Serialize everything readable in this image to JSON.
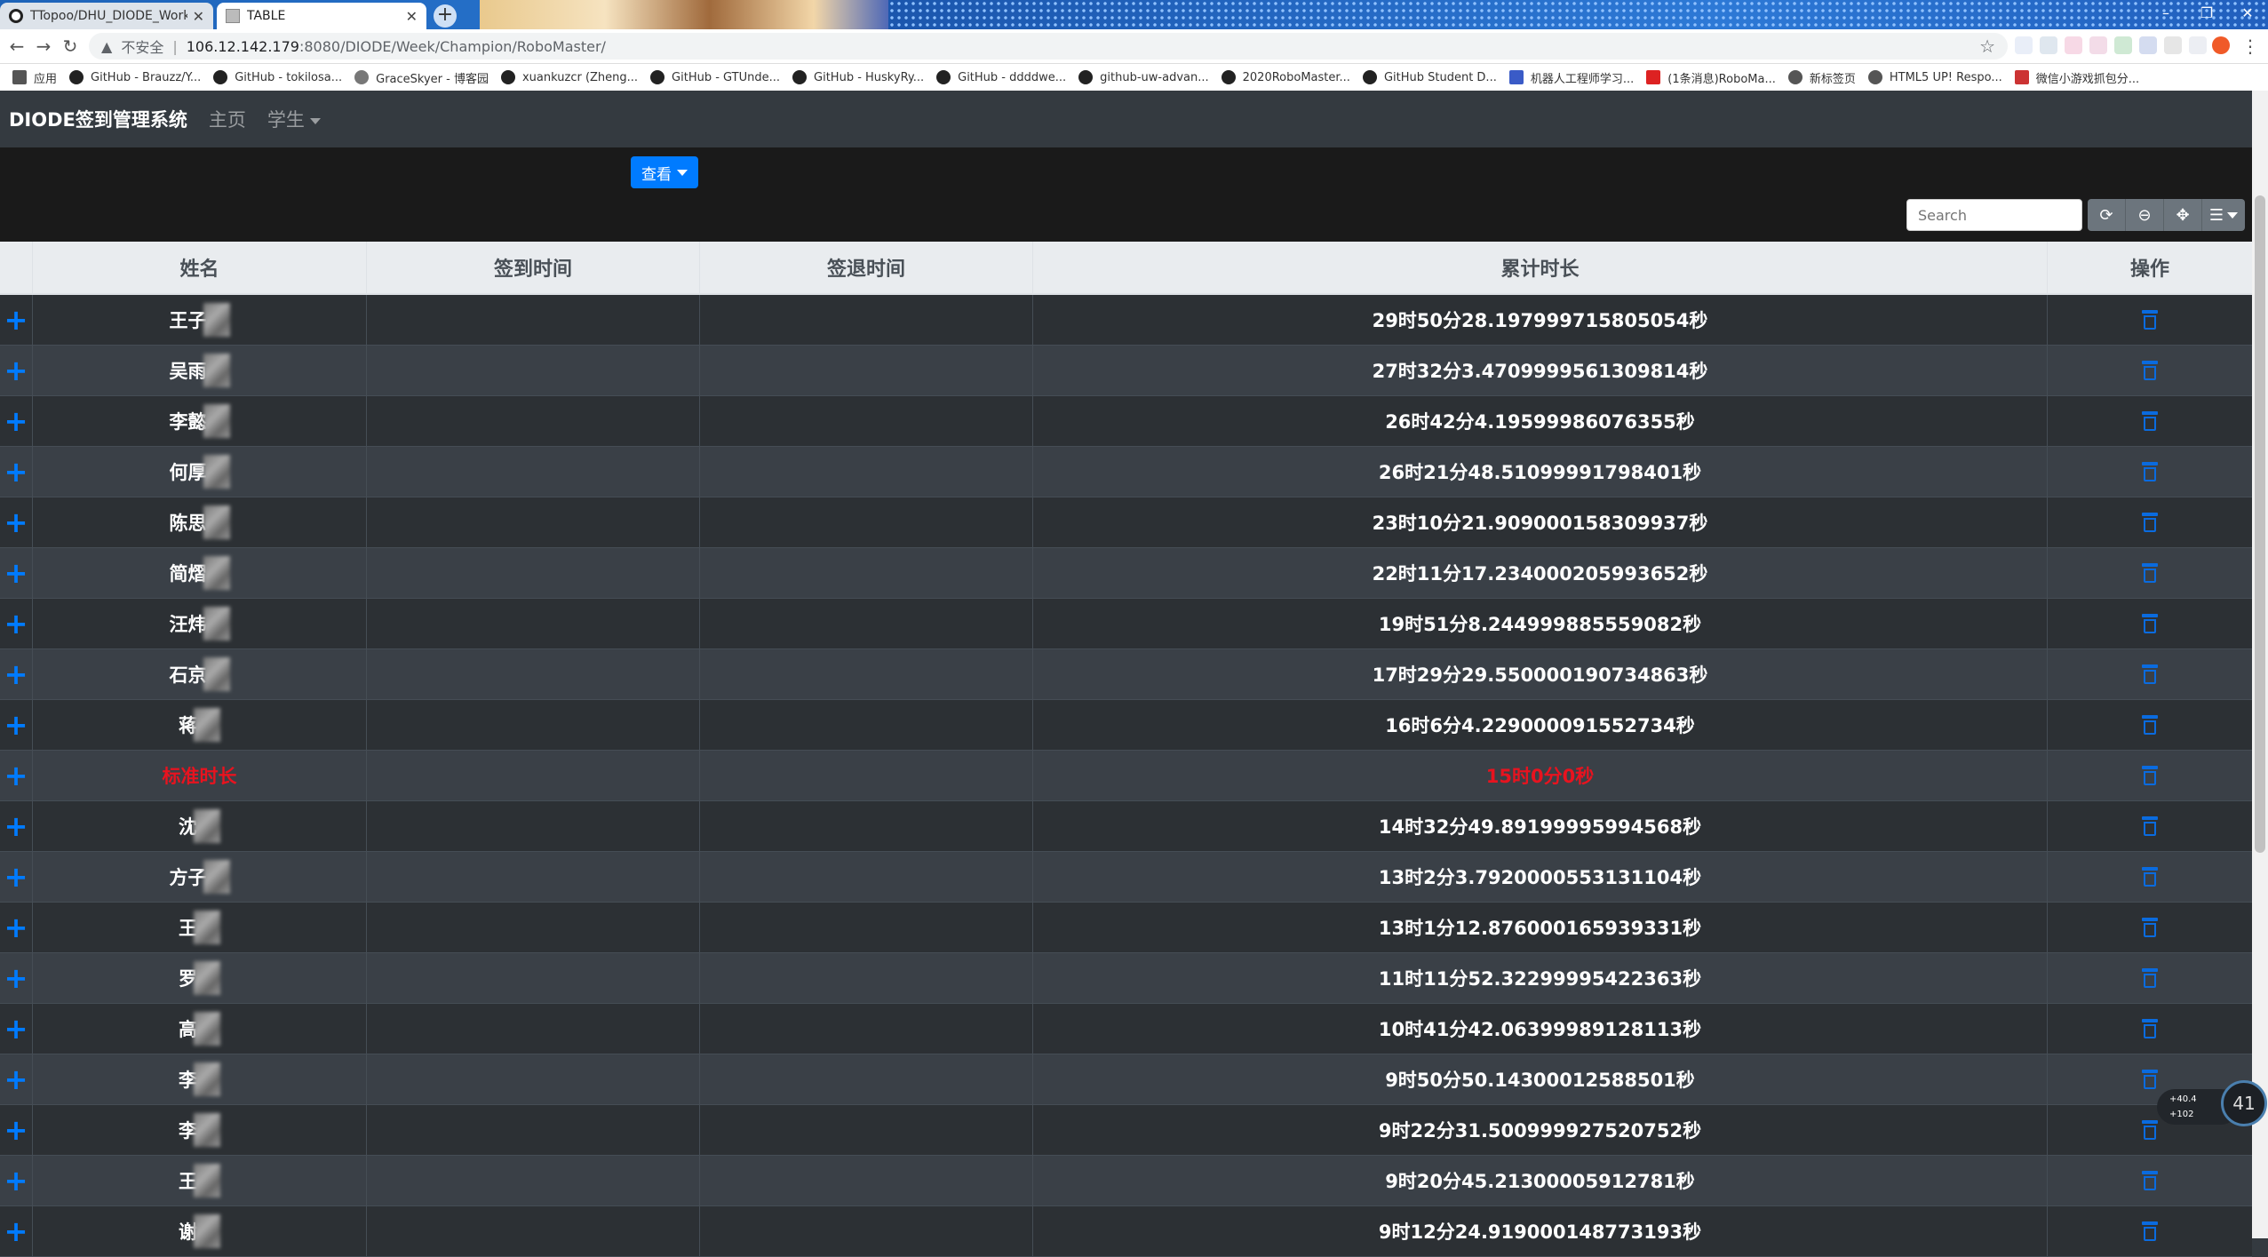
{
  "browser": {
    "tabs": [
      {
        "title": "TTopoo/DHU_DIODE_Workin",
        "active": false
      },
      {
        "title": "TABLE",
        "active": true
      }
    ],
    "url": {
      "security_label": "不安全",
      "host": "106.12.142.179",
      "path": ":8080/DIODE/Week/Champion/RoboMaster/"
    },
    "bookmarks": [
      "应用",
      "GitHub - Brauzz/Y...",
      "GitHub - tokilosa...",
      "GraceSkyer - 博客园",
      "xuankuzcr (Zheng...",
      "GitHub - GTUnde...",
      "GitHub - HuskyRy...",
      "GitHub - ddddwe...",
      "github-uw-advan...",
      "2020RoboMaster...",
      "GitHub Student D...",
      "机器人工程师学习...",
      "(1条消息)RoboMa...",
      "新标签页",
      "HTML5 UP! Respo...",
      "微信小游戏抓包分..."
    ]
  },
  "app": {
    "brand": "DIODE签到管理系统",
    "nav": [
      {
        "label": "主页"
      },
      {
        "label": "学生"
      }
    ],
    "view_button": "查看",
    "search_placeholder": "Search"
  },
  "table": {
    "headers": [
      "姓名",
      "签到时间",
      "签退时间",
      "累计时长",
      "操作"
    ],
    "rows": [
      {
        "name": "王子",
        "total": "29时50分28.197999715805054秒"
      },
      {
        "name": "吴雨",
        "total": "27时32分3.4709999561309814秒"
      },
      {
        "name": "李懿",
        "total": "26时42分4.19599986076355秒"
      },
      {
        "name": "何厚",
        "total": "26时21分48.51099991798401秒"
      },
      {
        "name": "陈思",
        "total": "23时10分21.909000158309937秒"
      },
      {
        "name": "简熠",
        "total": "22时11分17.234000205993652秒"
      },
      {
        "name": "汪炜",
        "total": "19时51分8.244999885559082秒"
      },
      {
        "name": "石京",
        "total": "17时29分29.550000190734863秒"
      },
      {
        "name": "蒋",
        "total": "16时6分4.229000091552734秒"
      },
      {
        "name": "标准时长",
        "total": "15时0分0秒",
        "standard": true
      },
      {
        "name": "沈",
        "total": "14时32分49.89199995994568秒"
      },
      {
        "name": "方子",
        "total": "13时2分3.7920000553131104秒"
      },
      {
        "name": "王",
        "total": "13时1分12.876000165939331秒"
      },
      {
        "name": "罗",
        "total": "11时11分52.32299995422363秒"
      },
      {
        "name": "高",
        "total": "10时41分42.06399989128113秒"
      },
      {
        "name": "李",
        "total": "9时50分50.14300012588501秒"
      },
      {
        "name": "李",
        "total": "9时22分31.500999927520752秒"
      },
      {
        "name": "王",
        "total": "9时20分45.21300005912781秒"
      },
      {
        "name": "谢",
        "total": "9时12分24.919000148773193秒"
      }
    ]
  },
  "speed_widget": {
    "up": "+40.4",
    "down": "+102",
    "percent": "41"
  },
  "colors": {
    "accent": "#007bff",
    "standard_row_text": "#e8131f",
    "table_bg": "#343a40"
  }
}
